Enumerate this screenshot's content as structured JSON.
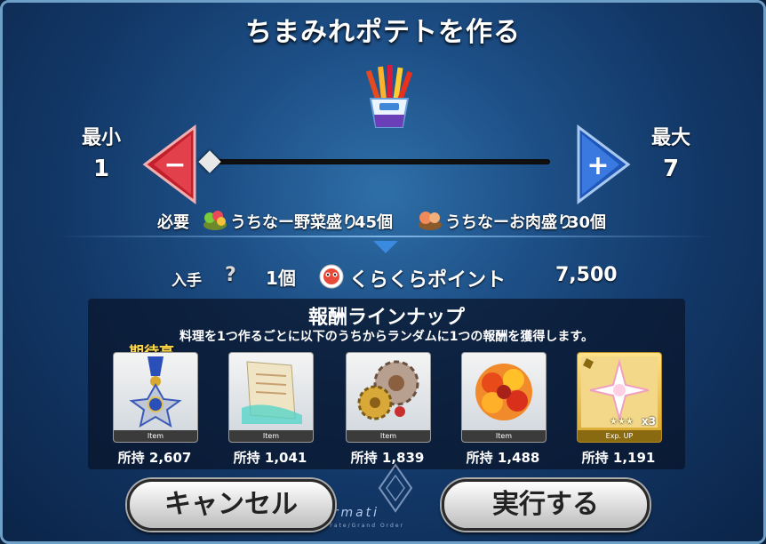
{
  "title": "ちまみれポテトを作る",
  "quantity": {
    "min_label": "最小",
    "min_value": "1",
    "max_label": "最大",
    "max_value": "7",
    "minus_symbol": "−",
    "plus_symbol": "+",
    "current_fraction": 0
  },
  "requirements": {
    "label": "必要",
    "item1_name": "うちなー野菜盛り",
    "item1_count": "45個",
    "item2_name": "うちなーお肉盛り",
    "item2_count": "30個"
  },
  "gain": {
    "label": "入手",
    "unknown_symbol": "?",
    "count": "1個",
    "point_name": "くらくらポイント",
    "point_value": "7,500"
  },
  "lineup": {
    "title": "報酬ラインナップ",
    "description": "料理を1つ作るごとに以下のうちからランダムに1つの報酬を獲得します。",
    "expect_label": "期待高",
    "rewards": [
      {
        "icon": "medal-icon",
        "tag": "Item",
        "held": "所持 2,607"
      },
      {
        "icon": "scroll-icon",
        "tag": "Item",
        "held": "所持 1,041"
      },
      {
        "icon": "gears-icon",
        "tag": "Item",
        "held": "所持 1,839"
      },
      {
        "icon": "flower-icon",
        "tag": "Item",
        "held": "所持 1,488"
      },
      {
        "icon": "exp-card-icon",
        "tag": "Exp. UP",
        "rarity": "★★★",
        "mult": "x3",
        "held": "所持 1,191"
      }
    ]
  },
  "buttons": {
    "cancel": "キャンセル",
    "execute": "実行する"
  },
  "watermark": {
    "text": "nfirmati",
    "sub": "Fate/Grand Order"
  },
  "colors": {
    "minus": "#d8303c",
    "plus": "#2f6fd0",
    "expect": "#ffd84a"
  }
}
